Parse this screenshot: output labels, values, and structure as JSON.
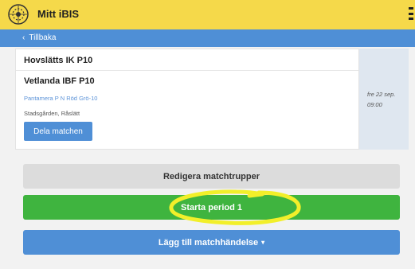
{
  "header": {
    "app_title": "Mitt iBIS",
    "logo_icon": "ibis-logo",
    "menu_icon": "hamburger-menu-icon"
  },
  "nav": {
    "back_label": "Tillbaka"
  },
  "match": {
    "home_team": "Hovslätts IK P10",
    "away_team": "Vetlanda IBF P10",
    "series": "Pantamera P N Röd Grö-10",
    "venue": "Stadsgården, Råslätt",
    "share_label": "Dela matchen",
    "date": "fre 22 sep.",
    "time": "09:00"
  },
  "actions": {
    "edit_label": "Redigera matchtrupper",
    "start_label": "Starta period 1",
    "add_event_label": "Lägg till matchhändelse",
    "add_event_caret": "▾"
  },
  "colors": {
    "topbar": "#f5d94a",
    "primary_blue": "#4f8fd6",
    "start_green": "#3fb43f",
    "highlight_yellow": "#f2ef2a"
  }
}
